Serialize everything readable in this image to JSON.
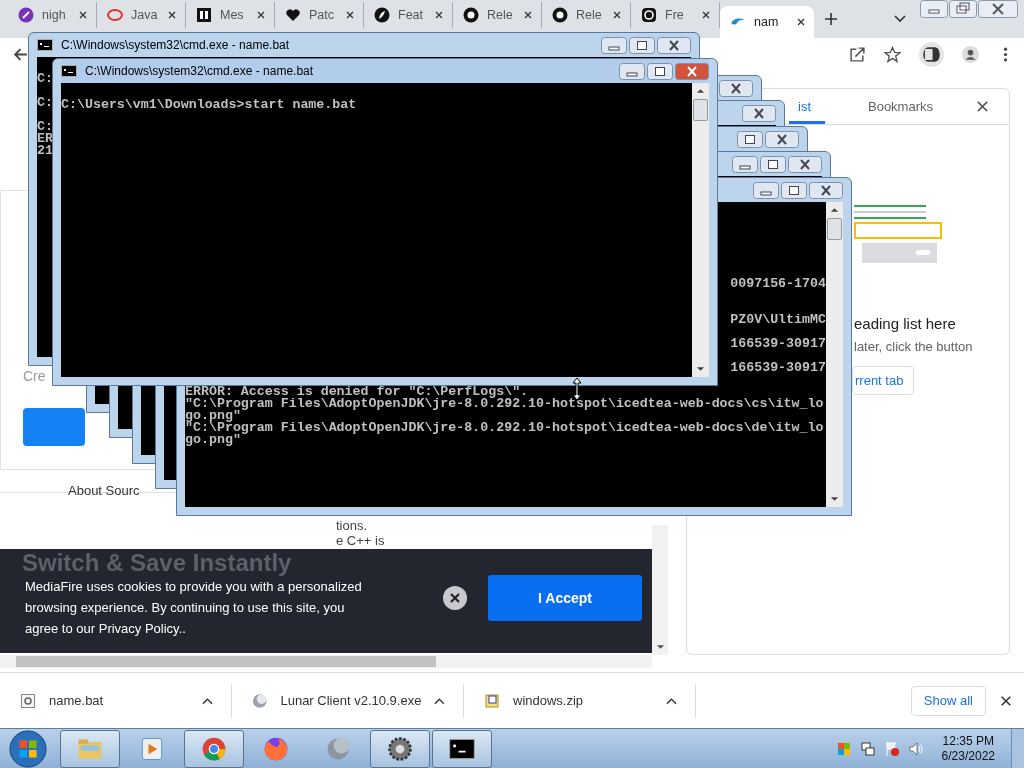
{
  "browser": {
    "tabs": [
      {
        "title": "nigh",
        "kind": "link",
        "selected": false
      },
      {
        "title": "Java",
        "kind": "oval",
        "selected": false
      },
      {
        "title": "Mes",
        "kind": "square",
        "selected": false
      },
      {
        "title": "Patc",
        "kind": "heart",
        "selected": false
      },
      {
        "title": "Feat",
        "kind": "feather",
        "selected": false
      },
      {
        "title": "Rele",
        "kind": "github",
        "selected": false
      },
      {
        "title": "Rele",
        "kind": "github",
        "selected": false
      },
      {
        "title": "Fre",
        "kind": "ring",
        "selected": false
      },
      {
        "title": "nam",
        "kind": "swirl",
        "selected": true
      }
    ]
  },
  "page": {
    "card_caption": "Cre",
    "section_title": "About Sourc",
    "text_lines": [
      "tions.",
      "e C++ is"
    ]
  },
  "cookie_banner": {
    "heading": "Switch & Save Instantly",
    "message": "MediaFire uses cookies to provide you with a personalized browsing experience. By continuing to use this site, you agree to our Privacy Policy..",
    "accept": "I Accept"
  },
  "side_panel": {
    "tabs": [
      {
        "label": "ist",
        "selected": true
      },
      {
        "label": "Bookmarks",
        "selected": false
      }
    ],
    "empty_title": "eading list here",
    "empty_hint": "later, click the button",
    "add_button": "rrent tab"
  },
  "console_windows": [
    {
      "kind": "cascade"
    },
    {
      "kind": "cascade"
    },
    {
      "kind": "cascade"
    },
    {
      "kind": "cascade"
    },
    {
      "kind": "cascade",
      "lines": [
        {
          "text": "0097156-1704",
          "kind": "tail"
        },
        {
          "text": "PZ0V\\UltimMC",
          "kind": "tail"
        },
        {
          "text": "166539-30917",
          "kind": "tail"
        },
        {
          "text": "166539-30917",
          "kind": "tail"
        },
        {
          "text": "ERROR: Access is denied for \"C:\\PerfLogs\\\".",
          "kind": "full"
        },
        {
          "text": "\"C:\\Program Files\\AdoptOpenJDK\\jre-8.0.292.10-hotspot\\icedtea-web-docs\\cs\\itw_lo",
          "kind": "full"
        },
        {
          "text": "go.png\"",
          "kind": "full"
        },
        {
          "text": "\"C:\\Program Files\\AdoptOpenJDK\\jre-8.0.292.10-hotspot\\icedtea-web-docs\\de\\itw_lo",
          "kind": "full"
        },
        {
          "text": "go.png\"",
          "kind": "full"
        }
      ]
    },
    {
      "kind": "titled",
      "title": "C:\\Windows\\system32\\cmd.exe - name.bat",
      "active": false,
      "lines": [
        {
          "text": "C:",
          "kind": "full"
        },
        {
          "text": "C:",
          "kind": "full"
        },
        {
          "text": "C:",
          "kind": "full"
        },
        {
          "text": "ER",
          "kind": "full"
        },
        {
          "text": "21",
          "kind": "full"
        }
      ]
    },
    {
      "kind": "titled",
      "title": "C:\\Windows\\system32\\cmd.exe - name.bat",
      "active": true,
      "lines": [
        {
          "text": "C:\\Users\\vm1\\Downloads>start name.bat",
          "kind": "full"
        }
      ]
    }
  ],
  "downloads": {
    "items": [
      {
        "name": "name.bat",
        "kind": "batch"
      },
      {
        "name": "Lunar Client v2.10.9.exe",
        "kind": "moon"
      },
      {
        "name": "windows.zip",
        "kind": "zip"
      }
    ],
    "show_all": "Show all"
  },
  "taskbar": {
    "apps": [
      {
        "kind": "folder",
        "running": true
      },
      {
        "kind": "media",
        "running": false
      },
      {
        "kind": "chrome",
        "running": true
      },
      {
        "kind": "firefox",
        "running": false
      },
      {
        "kind": "moon",
        "running": false
      },
      {
        "kind": "gear",
        "running": true
      },
      {
        "kind": "console",
        "running": true
      }
    ],
    "time": "12:35 PM",
    "date": "6/23/2022"
  }
}
